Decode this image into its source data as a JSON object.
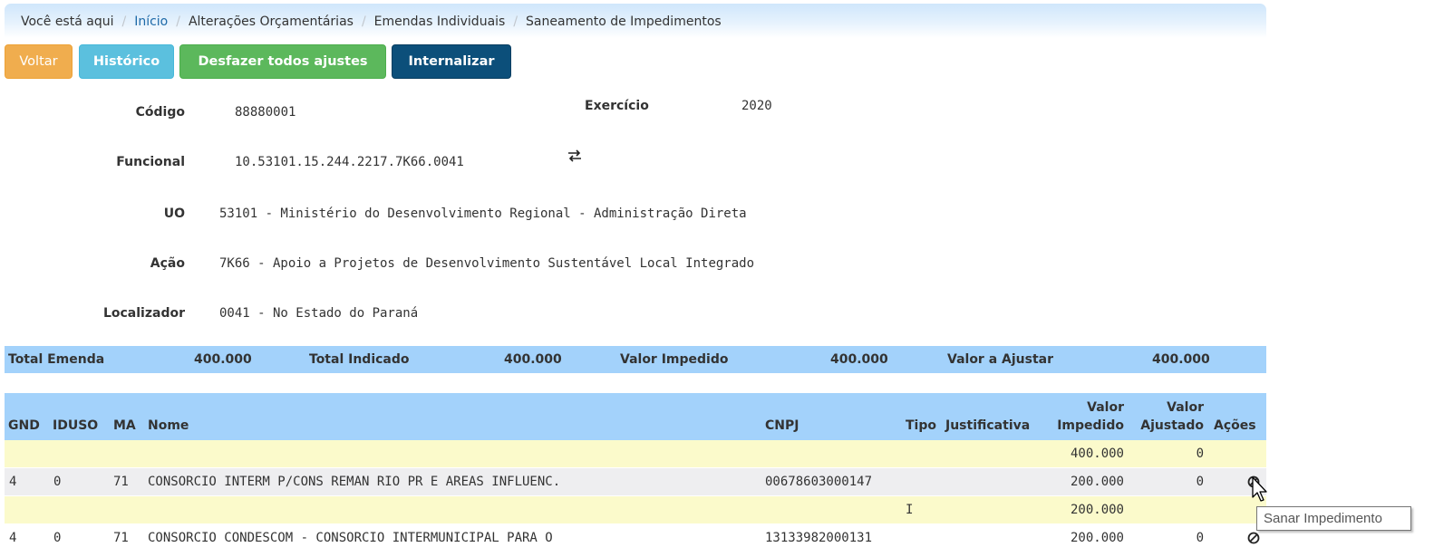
{
  "breadcrumb": {
    "items": [
      "Você está aqui",
      "Início",
      "Alterações Orçamentárias",
      "Emendas Individuais",
      "Saneamento de Impedimentos"
    ],
    "separator": "/"
  },
  "buttons": {
    "voltar": "Voltar",
    "historico": "Histórico",
    "desfazer": "Desfazer todos ajustes",
    "internalizar": "Internalizar"
  },
  "info": {
    "codigo_label": "Código",
    "codigo": "88880001",
    "exercicio_label": "Exercício",
    "exercicio": "2020",
    "funcional_label": "Funcional",
    "funcional": "10.53101.15.244.2217.7K66.0041",
    "uo_label": "UO",
    "uo": "53101 - Ministério do Desenvolvimento Regional - Administração Direta",
    "acao_label": "Ação",
    "acao": "7K66 - Apoio a Projetos de Desenvolvimento Sustentável Local Integrado",
    "localizador_label": "Localizador",
    "localizador": "0041 - No Estado do Paraná"
  },
  "totals": {
    "total_emenda_label": "Total Emenda",
    "total_emenda": "400.000",
    "total_indicado_label": "Total Indicado",
    "total_indicado": "400.000",
    "valor_impedido_label": "Valor Impedido",
    "valor_impedido": "400.000",
    "valor_ajustar_label": "Valor a Ajustar",
    "valor_ajustar": "400.000"
  },
  "table": {
    "headers": {
      "gnd": "GND",
      "iduso": "IDUSO",
      "ma": "MA",
      "nome": "Nome",
      "cnpj": "CNPJ",
      "tipo": "Tipo",
      "justificativa": "Justificativa",
      "valor_impedido_1": "Valor",
      "valor_impedido_2": "Impedido",
      "valor_ajustado_1": "Valor",
      "valor_ajustado_2": "Ajustado",
      "acoes": "Ações"
    },
    "rows": [
      {
        "gnd": "",
        "iduso": "",
        "ma": "",
        "nome": "",
        "cnpj": "",
        "tipo": "",
        "justificativa": "",
        "valor_impedido": "400.000",
        "valor_ajustado": "0"
      },
      {
        "gnd": "4",
        "iduso": "0",
        "ma": "71",
        "nome": "CONSORCIO INTERM P/CONS REMAN RIO PR E AREAS INFLUENC.",
        "cnpj": "00678603000147",
        "tipo": "",
        "justificativa": "",
        "valor_impedido": "200.000",
        "valor_ajustado": "0"
      },
      {
        "gnd": "",
        "iduso": "",
        "ma": "",
        "nome": "",
        "cnpj": "",
        "tipo": "I",
        "justificativa": "",
        "valor_impedido": "200.000",
        "valor_ajustado": ""
      },
      {
        "gnd": "4",
        "iduso": "0",
        "ma": "71",
        "nome": "CONSORCIO CONDESCOM - CONSORCIO INTERMUNICIPAL PARA O",
        "cnpj": "13133982000131",
        "tipo": "",
        "justificativa": "",
        "valor_impedido": "200.000",
        "valor_ajustado": "0"
      }
    ]
  },
  "tooltip": "Sanar Impedimento",
  "icons": {
    "funcional_swap": "swap-arrows-icon",
    "row_action": "prohibited-icon"
  }
}
